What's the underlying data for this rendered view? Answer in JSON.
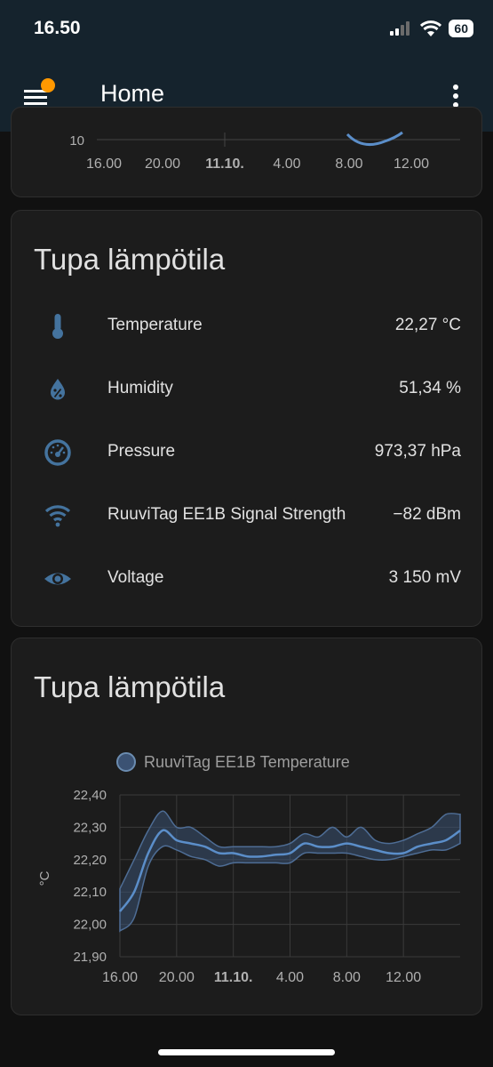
{
  "status": {
    "time": "16.50",
    "battery": "60"
  },
  "appbar": {
    "title": "Home",
    "menu_icon": "menu-icon",
    "more_icon": "dots-vertical-icon",
    "notification_color": "#ff9800"
  },
  "top_card": {
    "y_tick_visible": "10",
    "x_ticks": [
      "16.00",
      "20.00",
      "11.10.",
      "4.00",
      "8.00",
      "12.00"
    ]
  },
  "entities_card": {
    "title": "Tupa lämpötila",
    "rows": [
      {
        "icon": "thermometer-icon",
        "name": "Temperature",
        "value": "22,27 °C"
      },
      {
        "icon": "water-percent-icon",
        "name": "Humidity",
        "value": "51,34 %"
      },
      {
        "icon": "gauge-icon",
        "name": "Pressure",
        "value": "973,37 hPa"
      },
      {
        "icon": "wifi-icon",
        "name": "RuuviTag EE1B Signal Strength",
        "value": "−82 dBm"
      },
      {
        "icon": "eye-icon",
        "name": "Voltage",
        "value": "3 150 mV"
      }
    ],
    "icon_color": "#44739e"
  },
  "graph_card": {
    "title": "Tupa lämpötila",
    "legend": "RuuviTag EE1B Temperature"
  },
  "chart_data": {
    "type": "line",
    "ylabel": "°C",
    "ylim": [
      21.9,
      22.4
    ],
    "y_ticks": [
      "22,40",
      "22,30",
      "22,20",
      "22,10",
      "22,00",
      "21,90"
    ],
    "x_ticks": [
      "16.00",
      "20.00",
      "11.10.",
      "4.00",
      "8.00",
      "12.00"
    ],
    "x_hours": [
      0,
      1,
      2,
      3,
      4,
      5,
      6,
      7,
      8,
      9,
      10,
      11,
      12,
      13,
      14,
      15,
      16,
      17,
      18,
      19,
      20,
      21,
      22,
      23,
      24
    ],
    "series": [
      {
        "name": "RuuviTag EE1B Temperature",
        "color": "#5b8ec9",
        "mean": [
          22.04,
          22.1,
          22.22,
          22.29,
          22.26,
          22.25,
          22.24,
          22.22,
          22.22,
          22.21,
          22.21,
          22.215,
          22.22,
          22.25,
          22.24,
          22.24,
          22.25,
          22.24,
          22.23,
          22.22,
          22.22,
          22.24,
          22.25,
          22.26,
          22.29
        ],
        "min": [
          21.98,
          22.02,
          22.18,
          22.24,
          22.23,
          22.21,
          22.2,
          22.18,
          22.19,
          22.19,
          22.19,
          22.19,
          22.19,
          22.22,
          22.22,
          22.22,
          22.22,
          22.21,
          22.2,
          22.2,
          22.21,
          22.22,
          22.23,
          22.23,
          22.25
        ],
        "max": [
          22.11,
          22.2,
          22.29,
          22.35,
          22.3,
          22.3,
          22.27,
          22.24,
          22.24,
          22.24,
          22.24,
          22.24,
          22.25,
          22.28,
          22.27,
          22.3,
          22.27,
          22.3,
          22.26,
          22.25,
          22.26,
          22.28,
          22.3,
          22.34,
          22.34
        ]
      }
    ]
  }
}
